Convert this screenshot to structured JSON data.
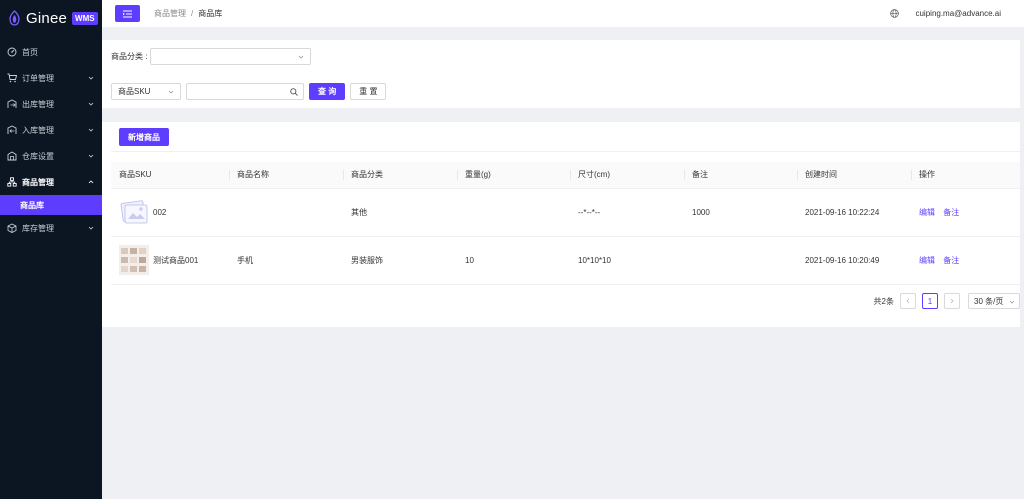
{
  "app": {
    "logo_text": "Ginee",
    "logo_badge": "WMS"
  },
  "header": {
    "breadcrumb_parent": "商品管理",
    "breadcrumb_sep": "/",
    "breadcrumb_current": "商品库",
    "user_email": "cuiping.ma@advance.ai"
  },
  "sidebar": {
    "items": [
      {
        "label": "首页"
      },
      {
        "label": "订单管理"
      },
      {
        "label": "出库管理"
      },
      {
        "label": "入库管理"
      },
      {
        "label": "仓库设置"
      },
      {
        "label": "商品管理"
      },
      {
        "label": "商品库"
      },
      {
        "label": "库存管理"
      }
    ]
  },
  "filters": {
    "category_label": "商品分类 :",
    "category_value": "",
    "sku_select_value": "商品SKU",
    "search_value": "",
    "query_button": "查 询",
    "reset_button": "重 置"
  },
  "table": {
    "add_button": "新增商品",
    "columns": [
      "商品SKU",
      "商品名称",
      "商品分类",
      "重量(g)",
      "尺寸(cm)",
      "备注",
      "创建时间",
      "操作"
    ],
    "rows": [
      {
        "sku": "002",
        "name": "",
        "category": "其他",
        "weight": "",
        "size": "--*--*--",
        "remark": "1000",
        "created": "2021-09-16 10:22:24",
        "edit": "编辑",
        "note": "备注"
      },
      {
        "sku": "测试商品001",
        "name": "手机",
        "category": "男装服饰",
        "weight": "10",
        "size": "10*10*10",
        "remark": "",
        "created": "2021-09-16 10:20:49",
        "edit": "编辑",
        "note": "备注"
      }
    ]
  },
  "pagination": {
    "total": "共2条",
    "current_page": "1",
    "page_size": "30 条/页"
  },
  "colors": {
    "accent": "#5f3dff",
    "sidebar_bg": "#0c1622"
  }
}
